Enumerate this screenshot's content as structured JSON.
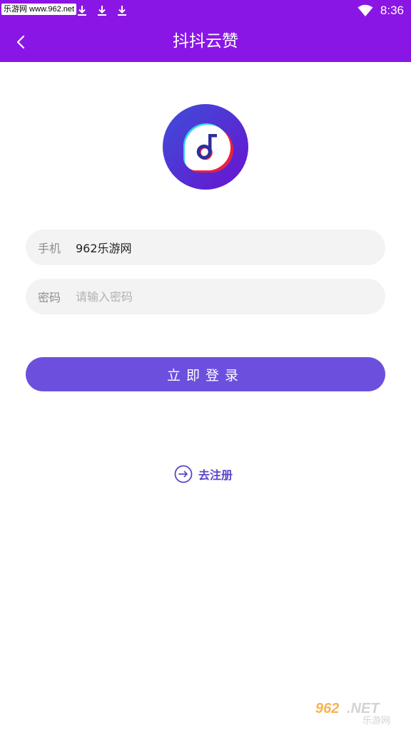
{
  "statusbar": {
    "watermark": "乐游网 www.962.net",
    "time": "8:36",
    "icons": [
      "download-icon",
      "download-icon",
      "download-icon",
      "wifi-icon"
    ]
  },
  "titlebar": {
    "title": "抖抖云赞",
    "back_icon": "chevron-left-icon"
  },
  "form": {
    "phone": {
      "label": "手机",
      "value": "962乐游网"
    },
    "password": {
      "label": "密码",
      "placeholder": "请输入密码",
      "value": ""
    },
    "login_label": "立即登录"
  },
  "register": {
    "label": "去注册",
    "icon": "arrow-right-circle-icon"
  },
  "corner_watermark": {
    "brand": "962.NET",
    "sub": "乐游网"
  },
  "colors": {
    "header": "#8a16e6",
    "primary": "#6d4fde",
    "link": "#5c46c7",
    "field_bg": "#f3f3f3"
  }
}
